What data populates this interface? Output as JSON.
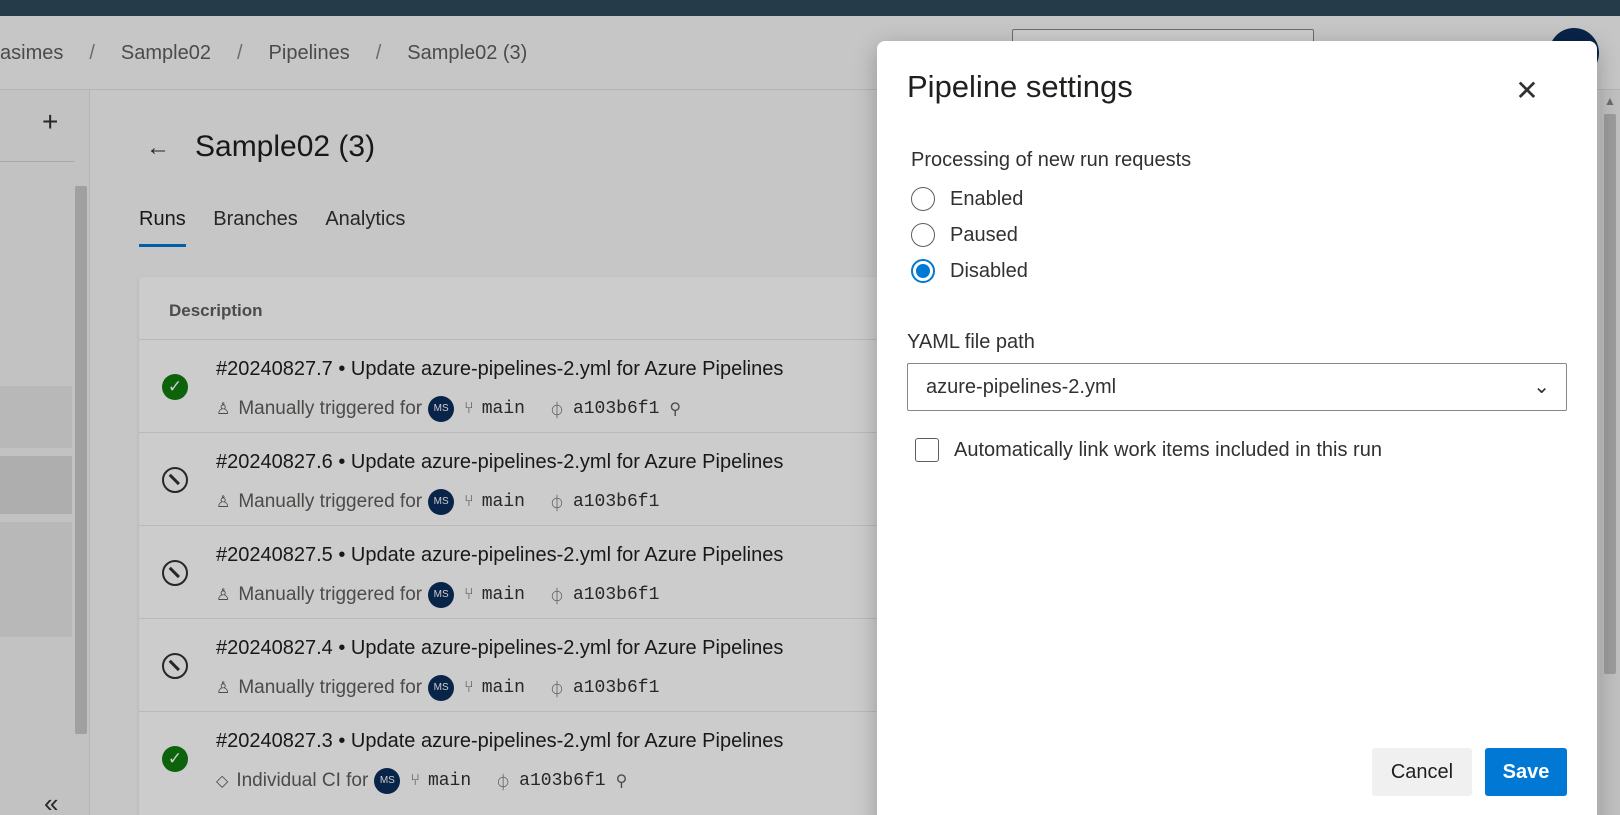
{
  "breadcrumb": [
    "asimes",
    "Sample02",
    "Pipelines",
    "Sample02 (3)"
  ],
  "breadcrumb_separator": "/",
  "sidebar": {
    "add_label": "+",
    "collapse_label": "«"
  },
  "page": {
    "back_label": "←",
    "title": "Sample02 (3)",
    "tabs": [
      {
        "label": "Runs",
        "active": true
      },
      {
        "label": "Branches",
        "active": false
      },
      {
        "label": "Analytics",
        "active": false
      }
    ]
  },
  "runs": {
    "column_header": "Description",
    "items": [
      {
        "title": "#20240827.7 • Update azure-pipelines-2.yml for Azure Pipelines",
        "status": "succeeded",
        "trigger": "Manually triggered for",
        "avatar": "MS",
        "branch": "main",
        "commit": "a103b6f1",
        "pinned": true
      },
      {
        "title": "#20240827.6 • Update azure-pipelines-2.yml for Azure Pipelines",
        "status": "canceled",
        "trigger": "Manually triggered for",
        "avatar": "MS",
        "branch": "main",
        "commit": "a103b6f1",
        "pinned": false
      },
      {
        "title": "#20240827.5 • Update azure-pipelines-2.yml for Azure Pipelines",
        "status": "canceled",
        "trigger": "Manually triggered for",
        "avatar": "MS",
        "branch": "main",
        "commit": "a103b6f1",
        "pinned": false
      },
      {
        "title": "#20240827.4 • Update azure-pipelines-2.yml for Azure Pipelines",
        "status": "canceled",
        "trigger": "Manually triggered for",
        "avatar": "MS",
        "branch": "main",
        "commit": "a103b6f1",
        "pinned": false
      },
      {
        "title": "#20240827.3 • Update azure-pipelines-2.yml for Azure Pipelines",
        "status": "succeeded",
        "trigger": "Individual CI for",
        "avatar": "MS",
        "branch": "main",
        "commit": "a103b6f1",
        "pinned": true
      }
    ]
  },
  "dialog": {
    "title": "Pipeline settings",
    "close_label": "✕",
    "processing_label": "Processing of new run requests",
    "options": [
      {
        "label": "Enabled",
        "checked": false
      },
      {
        "label": "Paused",
        "checked": false
      },
      {
        "label": "Disabled",
        "checked": true
      }
    ],
    "yaml_label": "YAML file path",
    "yaml_value": "azure-pipelines-2.yml",
    "autolink_label": "Automatically link work items included in this run",
    "autolink_checked": false,
    "cancel_label": "Cancel",
    "save_label": "Save"
  },
  "colors": {
    "accent": "#0078d4",
    "success": "#107c10",
    "avatar_bg": "#0b2d5b",
    "topbar": "#2f4a5c"
  }
}
